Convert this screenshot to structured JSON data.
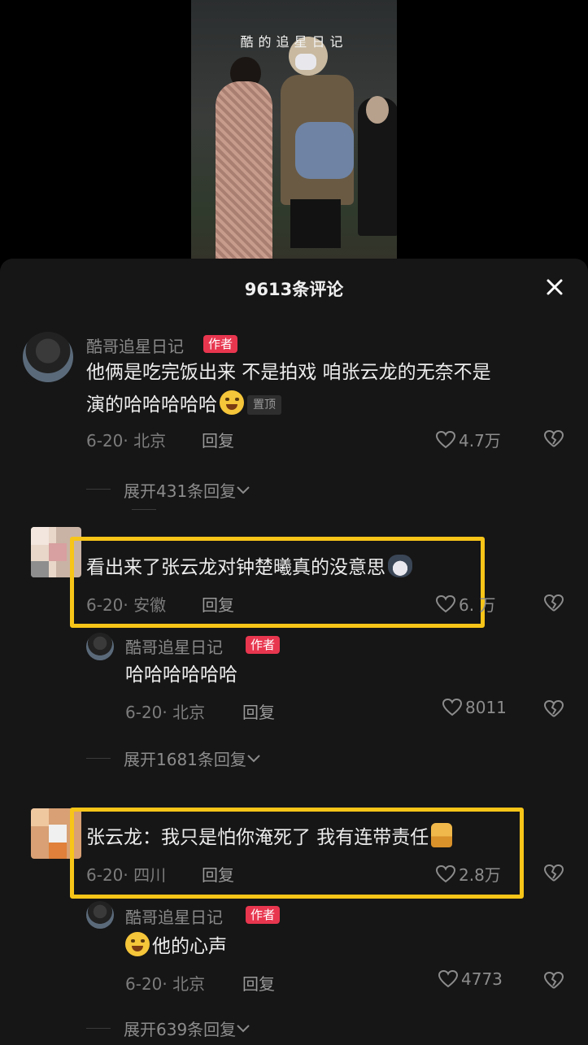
{
  "video": {
    "watermark": "酷的追星日记"
  },
  "sheet": {
    "title": "9613条评论"
  },
  "comments": [
    {
      "name": "酷哥追星日记",
      "badge": "作者",
      "text_line1": "他俩是吃完饭出来 不是拍戏 咱张云龙的无奈不是",
      "text_line2": "演的哈哈哈哈哈",
      "pin": "置顶",
      "meta": "6-20· 北京",
      "reply": "回复",
      "likes": "4.7万",
      "expand": "展开431条回复"
    },
    {
      "text": "看出来了张云龙对钟楚曦真的没意思",
      "meta": "6-20· 安徽",
      "reply": "回复",
      "likes": "6.  万",
      "sub": {
        "name": "酷哥追星日记",
        "badge": "作者",
        "text": "哈哈哈哈哈哈",
        "meta": "6-20· 北京",
        "reply": "回复",
        "likes": "8011"
      },
      "expand": "展开1681条回复"
    },
    {
      "text": "张云龙：我只是怕你淹死了 我有连带责任",
      "meta": "6-20· 四川",
      "reply": "回复",
      "likes": "2.8万",
      "sub": {
        "name": "酷哥追星日记",
        "badge": "作者",
        "text": "他的心声",
        "meta": "6-20· 北京",
        "reply": "回复",
        "likes": "4773"
      },
      "expand": "展开639条回复"
    }
  ],
  "colors": {
    "highlight": "#f7c518",
    "author_badge": "#e8364f",
    "sheet_bg": "#161616"
  }
}
